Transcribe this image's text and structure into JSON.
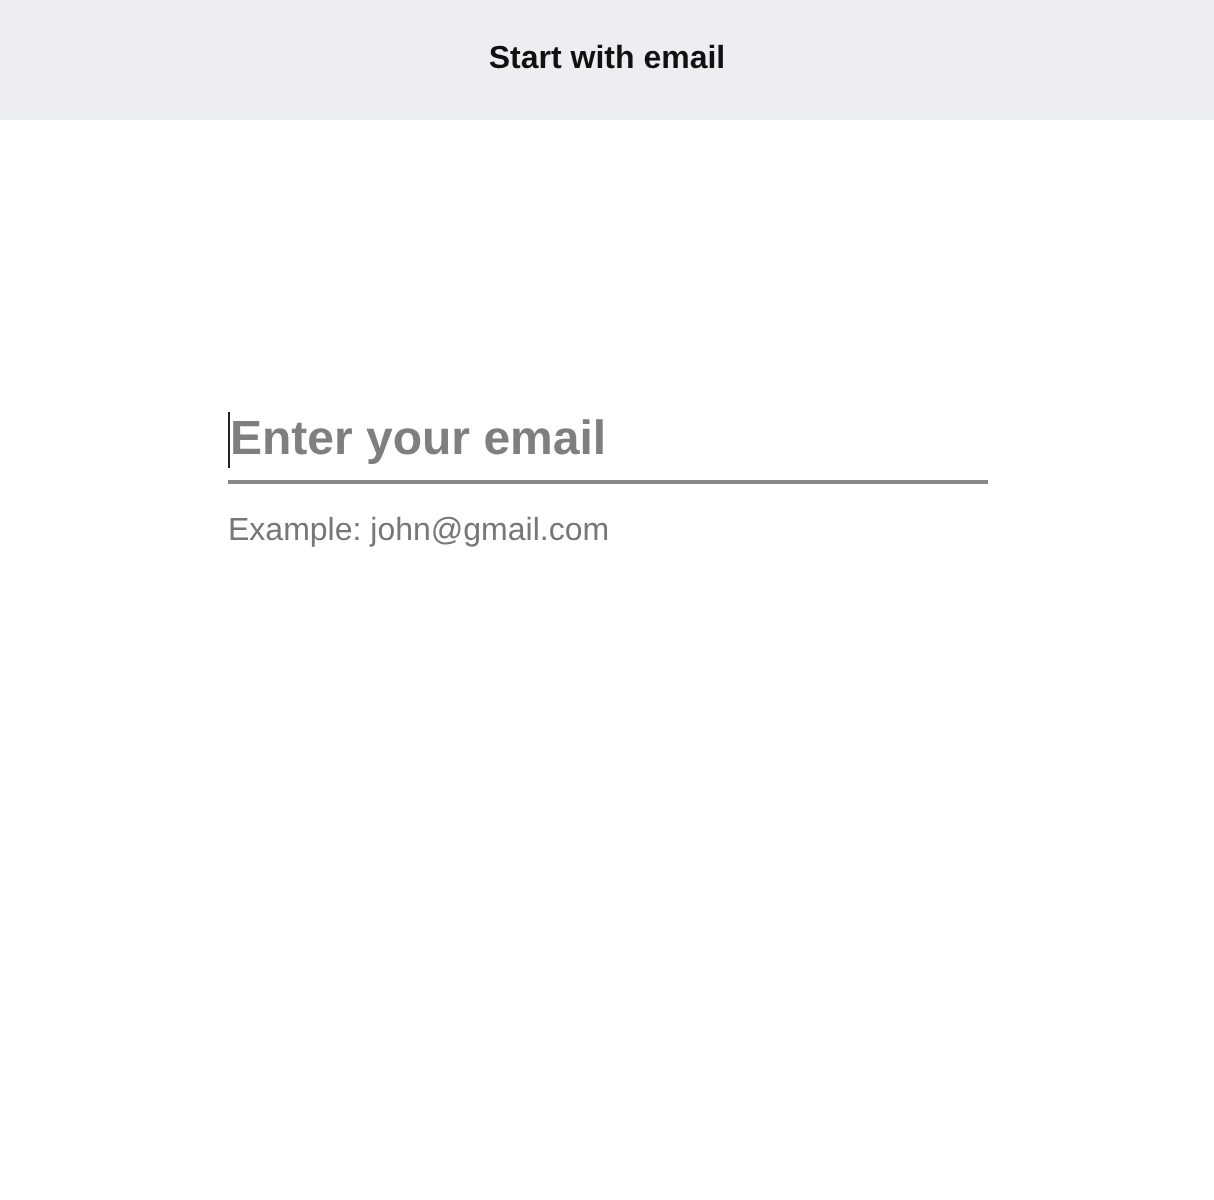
{
  "header": {
    "title": "Start with email"
  },
  "email_field": {
    "placeholder": "Enter your email",
    "focused": true,
    "hint": "Example: john@gmail.com"
  }
}
